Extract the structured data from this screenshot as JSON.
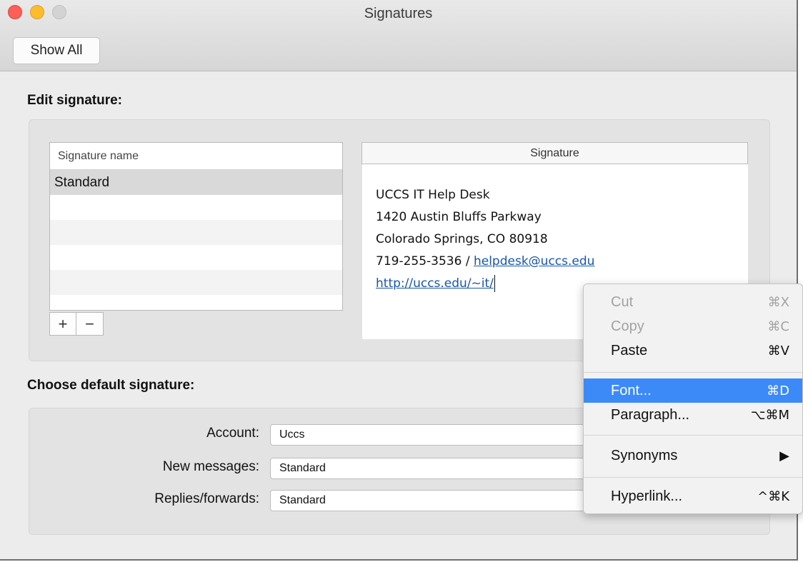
{
  "window": {
    "title": "Signatures",
    "show_all": "Show All"
  },
  "edit": {
    "label": "Edit signature:",
    "list": {
      "header": "Signature name",
      "items": [
        "Standard"
      ]
    },
    "add_icon": "+",
    "remove_icon": "−",
    "signature_header": "Signature",
    "signature": {
      "line1": "UCCS IT Help Desk",
      "line2": "1420 Austin Bluffs Parkway",
      "line3": "Colorado Springs, CO 80918",
      "line4_prefix": "719-255-3536 / ",
      "email": "helpdesk@uccs.edu",
      "url": "http://uccs.edu/~it/"
    }
  },
  "default": {
    "label": "Choose default signature:",
    "account_label": "Account:",
    "account_value": "Uccs",
    "new_label": "New messages:",
    "new_value": "Standard",
    "replies_label": "Replies/forwards:",
    "replies_value": "Standard"
  },
  "menu": {
    "items": [
      {
        "label": "Cut",
        "shortcut": "⌘X",
        "enabled": false
      },
      {
        "label": "Copy",
        "shortcut": "⌘C",
        "enabled": false
      },
      {
        "label": "Paste",
        "shortcut": "⌘V",
        "enabled": true
      },
      {
        "label": "Font...",
        "shortcut": "⌘D",
        "enabled": true,
        "highlighted": true
      },
      {
        "label": "Paragraph...",
        "shortcut": "⌥⌘M",
        "enabled": true
      },
      {
        "label": "Synonyms",
        "shortcut": "▶",
        "enabled": true
      },
      {
        "label": "Hyperlink...",
        "shortcut": "^⌘K",
        "enabled": true
      }
    ]
  },
  "colors": {
    "highlight": "#3c8af7",
    "link": "#1a55a8",
    "close": "#fc5f57",
    "minimize": "#fdbc2e"
  }
}
